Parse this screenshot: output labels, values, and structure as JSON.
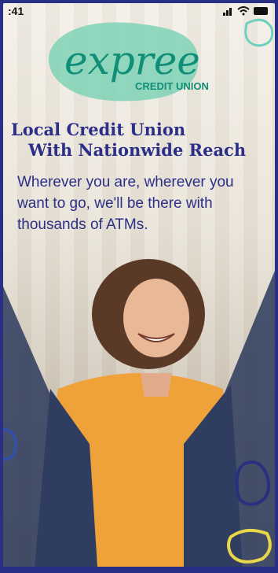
{
  "status_bar": {
    "time": ":41"
  },
  "logo": {
    "wordmark": "expree",
    "tagline": "CREDIT UNION",
    "brand_color": "#0f8f78",
    "blob_color": "#7fd2b6"
  },
  "hero": {
    "headline_line1": "Local Credit Union",
    "headline_line2": "With Nationwide Reach",
    "body": "Wherever you are, wherever you want to go, we'll be there with thousands of ATMs."
  },
  "colors": {
    "headline": "#2b2f87",
    "frame": "#2a2f86",
    "accent_yellow": "#e8d74a",
    "accent_teal": "#6fd0c0"
  }
}
